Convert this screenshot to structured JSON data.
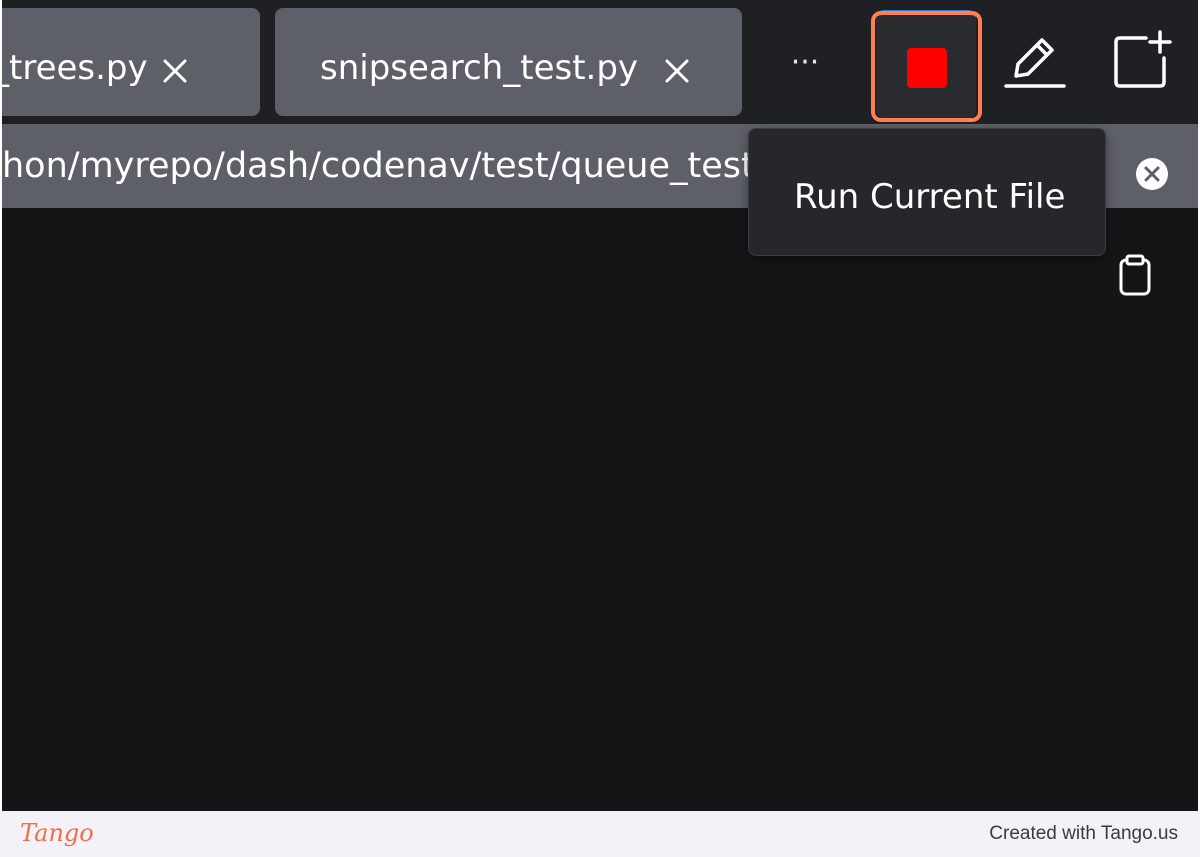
{
  "tabs": [
    {
      "label": "_trees.py"
    },
    {
      "label": "snipsearch_test.py"
    }
  ],
  "toolbar": {
    "overflow_label": "···",
    "run_icon": "stop-square-icon",
    "run_color": "#ff0000",
    "highlight_color": "#ff7f50"
  },
  "path": {
    "value": "hon/myrepo/dash/codenav/test/queue_test.py"
  },
  "tooltip": {
    "text": "Run Current File"
  },
  "footer": {
    "logo": "Tango",
    "credit": "Created with Tango.us"
  }
}
